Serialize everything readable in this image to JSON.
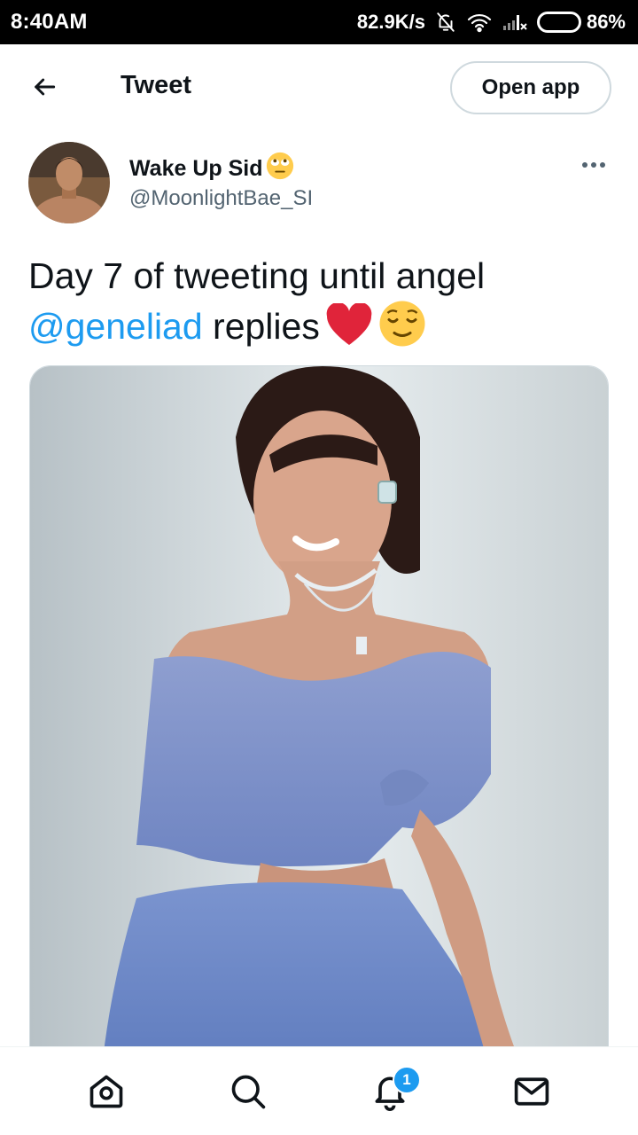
{
  "status_bar": {
    "time": "8:40AM",
    "net_speed": "82.9K/s",
    "battery_percent": "86%",
    "battery_level": 0.86,
    "icons": [
      "bell-off-icon",
      "wifi-icon",
      "signal-icon",
      "battery-icon"
    ]
  },
  "header": {
    "back_icon": "arrow-left-icon",
    "title": "Tweet",
    "open_app_label": "Open app"
  },
  "tweet": {
    "author_name": "Wake Up Sid",
    "author_emoji": "face-with-rolling-eyes",
    "author_handle": "@MoonlightBae_SI",
    "text_prefix": "Day 7 of tweeting until angel ",
    "mention": "@geneliad",
    "text_suffix": " replies",
    "text_emojis": [
      "red-heart",
      "relieved-face"
    ],
    "more_icon": "more-horizontal-icon",
    "media_alt": "photo"
  },
  "bottom_nav": {
    "items": [
      {
        "name": "home",
        "icon": "home-icon"
      },
      {
        "name": "search",
        "icon": "search-icon"
      },
      {
        "name": "notifications",
        "icon": "bell-icon",
        "badge": "1"
      },
      {
        "name": "messages",
        "icon": "mail-icon"
      }
    ]
  },
  "colors": {
    "accent": "#1d9bf0",
    "text_primary": "#0f1419",
    "text_secondary": "#536471",
    "heart": "#e0243a",
    "emoji_yellow": "#ffcc4d"
  }
}
